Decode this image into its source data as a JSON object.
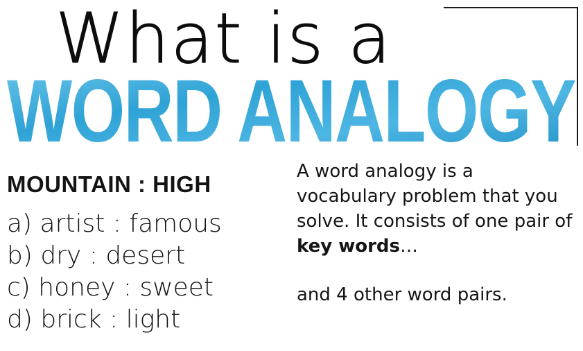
{
  "title": {
    "line1": "What is a",
    "line2": "WORD ANALOGY"
  },
  "colors": {
    "title_blue": "#2fa3d6",
    "title_blue_light": "#6ec6ea",
    "text": "#141414"
  },
  "example": {
    "key_pair": "MOUNTAIN : HIGH",
    "options": [
      "a) artist : famous",
      "b) dry : desert",
      "c) honey : sweet",
      "d) brick : light"
    ]
  },
  "description": {
    "part1": "A word analogy is a vocabulary problem that you solve. It consists of one pair of ",
    "bold": "key words",
    "part2": "…",
    "line2": "and 4 other word pairs."
  }
}
